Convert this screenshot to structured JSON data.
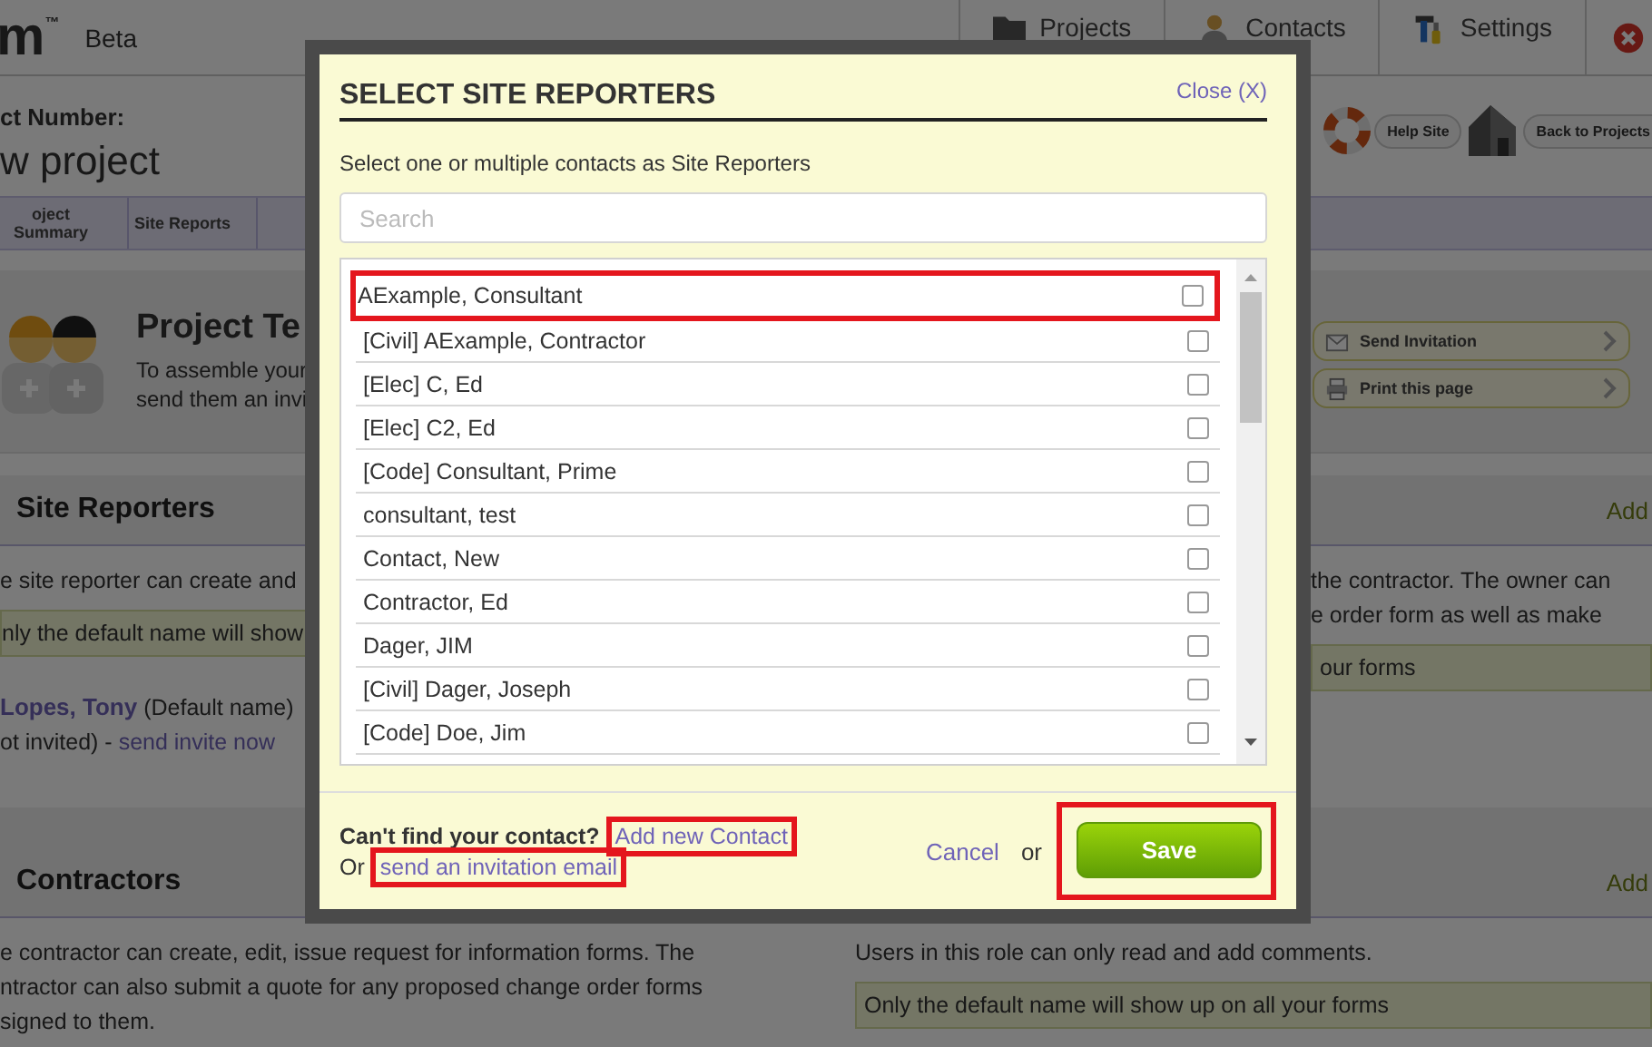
{
  "header": {
    "logo": "m",
    "logo_mark": "™",
    "edition": "Beta",
    "nav": [
      {
        "kind": "folder",
        "label": "Projects"
      },
      {
        "kind": "person",
        "label": "Contacts"
      },
      {
        "kind": "tools",
        "label": "Settings"
      },
      {
        "kind": "close"
      }
    ]
  },
  "project": {
    "number_label": "ct Number:",
    "name": "w project",
    "help_button": "Help Site",
    "back_button": "Back to Projects"
  },
  "tabs": [
    {
      "label": "oject Summary",
      "selected": false
    },
    {
      "label": "Site Reports",
      "selected": false
    }
  ],
  "team": {
    "title": "Project Te",
    "lines": [
      "To assemble your",
      "send them an invi"
    ],
    "actions": [
      {
        "kind": "send",
        "label": "Send Invitation"
      },
      {
        "kind": "print",
        "label": "Print this page"
      }
    ]
  },
  "sections": [
    {
      "title": "Site Reporters",
      "add": "Add",
      "left_lines": [
        "e site reporter can create and"
      ],
      "left_note": "nly the default name will show",
      "member": {
        "name": "Lopes, Tony",
        "suffix": "(Default name)",
        "status": "ot invited) - ",
        "invite_link": "send invite now"
      },
      "right_lines": [
        "the contractor. The owner can",
        "e order form as well as make"
      ],
      "right_note": "our forms"
    },
    {
      "title": "Contractors",
      "add": "Add",
      "left_lines": [
        "e contractor can create, edit, issue request for information forms. The",
        "ntractor can also submit a quote for any proposed change order forms",
        "signed to them."
      ],
      "right_lines": [
        "Users in this role can only read and add comments."
      ],
      "right_note": "Only the default name will show up on all your forms"
    }
  ],
  "dialog": {
    "title": "SELECT SITE REPORTERS",
    "close": "Close (X)",
    "subtitle": "Select one or multiple contacts as Site Reporters",
    "search": {
      "placeholder": "Search"
    },
    "contacts": [
      {
        "name": "AExample, Consultant",
        "checked": false,
        "highlighted": true
      },
      {
        "name": "[Civil] AExample, Contractor",
        "checked": false,
        "highlighted": false
      },
      {
        "name": "[Elec] C, Ed",
        "checked": false,
        "highlighted": false
      },
      {
        "name": "[Elec] C2, Ed",
        "checked": false,
        "highlighted": false
      },
      {
        "name": "[Code] Consultant, Prime",
        "checked": false,
        "highlighted": false
      },
      {
        "name": "consultant, test",
        "checked": false,
        "highlighted": false
      },
      {
        "name": "Contact, New",
        "checked": false,
        "highlighted": false
      },
      {
        "name": "Contractor, Ed",
        "checked": false,
        "highlighted": false
      },
      {
        "name": "Dager, JIM",
        "checked": false,
        "highlighted": false
      },
      {
        "name": "[Civil] Dager, Joseph",
        "checked": false,
        "highlighted": false
      },
      {
        "name": "[Code] Doe, Jim",
        "checked": false,
        "highlighted": false
      }
    ],
    "prompt": "Can't find your contact?",
    "add_link": {
      "label": "Add new Contact",
      "highlighted": true
    },
    "or_label": "Or",
    "invite_link": {
      "label": "send an invitation email",
      "highlighted": true
    },
    "cancel": "Cancel",
    "or_between": "or",
    "save": {
      "label": "Save",
      "highlighted": true
    }
  }
}
